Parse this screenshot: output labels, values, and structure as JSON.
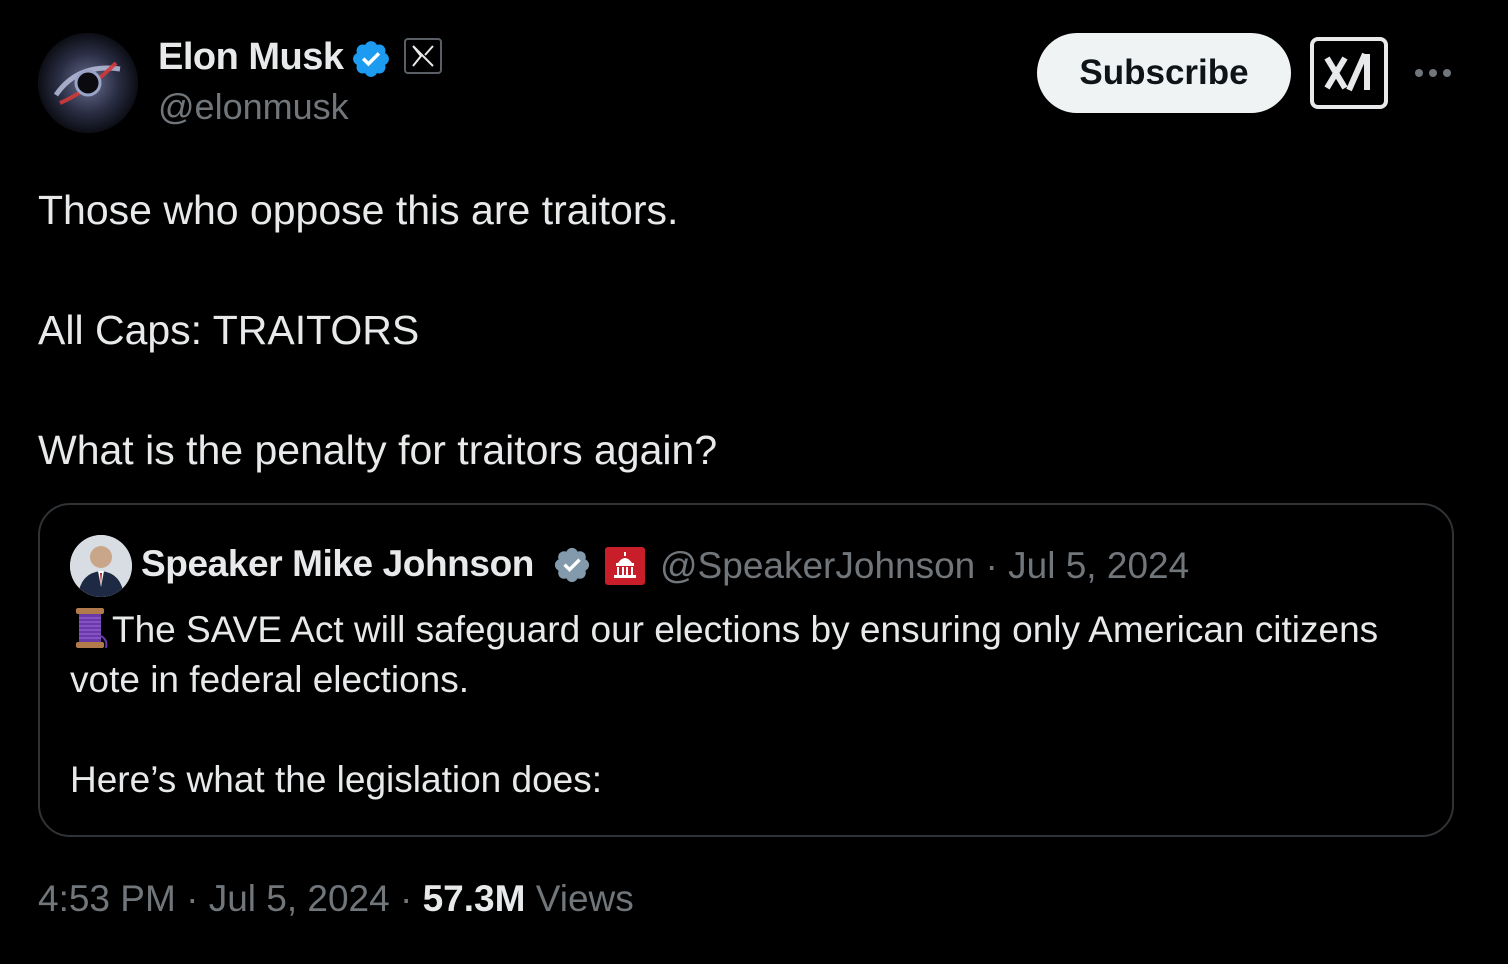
{
  "author": {
    "name": "Elon Musk",
    "handle": "@elonmusk",
    "verified_color": "#1d9bf0"
  },
  "header": {
    "subscribe_label": "Subscribe",
    "grok_icon": "xai-grok-icon",
    "more_icon": "more-horizontal-icon"
  },
  "tweet": {
    "paragraphs": [
      "Those who oppose this are traitors.",
      "All Caps: TRAITORS",
      "What is the penalty for traitors again?"
    ]
  },
  "quote": {
    "name": "Speaker Mike Johnson",
    "handle": "@SpeakerJohnson",
    "separator": "·",
    "date": "Jul 5, 2024",
    "verified_color": "#829aab",
    "line1": "The SAVE Act will safeguard our elections by ensuring only American citizens vote in federal elections.",
    "line2": "Here’s what the legislation does:",
    "emoji_icon": "spool-of-thread-icon"
  },
  "footer": {
    "time": "4:53 PM",
    "sep1": "·",
    "date": "Jul 5, 2024",
    "sep2": "·",
    "views_count": "57.3M",
    "views_label": "Views"
  }
}
